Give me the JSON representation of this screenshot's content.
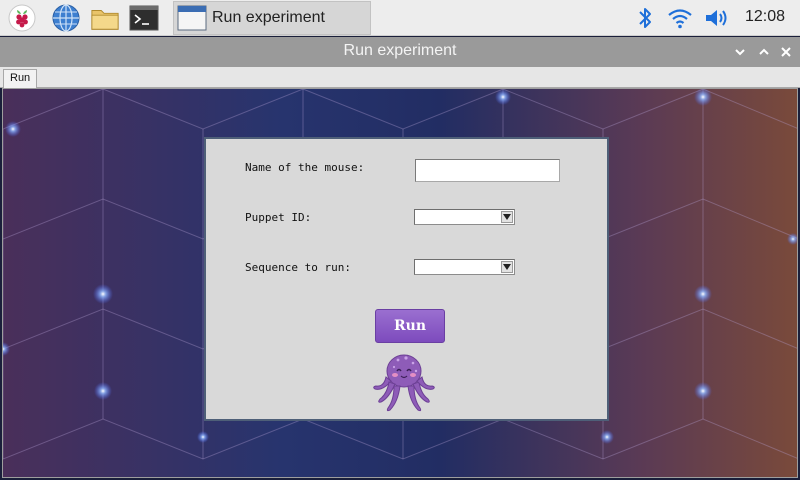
{
  "taskbar": {
    "icons": {
      "menu": "raspberry-pi-icon",
      "browser": "globe-icon",
      "files": "folder-icon",
      "terminal": "terminal-icon",
      "bluetooth": "bluetooth-icon",
      "wifi": "wifi-icon",
      "volume": "volume-icon"
    },
    "task_button_label": "Run experiment",
    "clock": "12:08"
  },
  "window": {
    "title": "Run experiment",
    "controls": [
      "minimize",
      "maximize",
      "close"
    ]
  },
  "tabs": [
    {
      "label": "Run",
      "active": true
    }
  ],
  "form": {
    "name_label": "Name of the mouse:",
    "name_value": "",
    "puppet_label": "Puppet ID:",
    "puppet_selected": "",
    "sequence_label": "Sequence to run:",
    "sequence_selected": "",
    "run_button": "Run",
    "mascot": "octopus-icon"
  },
  "colors": {
    "taskbar_bg": "#ededed",
    "titlebar_bg": "#9a9a9a",
    "panel_bg": "#d9d9d9",
    "panel_border": "#4e5f78",
    "run_button": "#8b5cc6",
    "accent_blue": "#2b7fd6"
  }
}
